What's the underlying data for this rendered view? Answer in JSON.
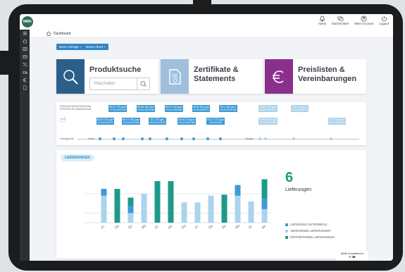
{
  "header": {
    "logo_text": "MMK",
    "nav": [
      {
        "label": "Alerts",
        "icon": "bell-icon"
      },
      {
        "label": "Nachrichten",
        "icon": "chat-icon"
      },
      {
        "label": "Mein Account",
        "icon": "user-icon"
      },
      {
        "label": "Logout",
        "icon": "power-icon"
      }
    ]
  },
  "breadcrumb": {
    "label": "Dashboard"
  },
  "actions": {
    "new_request": "Neue Anfrage +",
    "new_abruf": "Neuer Abruf +"
  },
  "cards": [
    {
      "title": "Produktsuche",
      "search_placeholder": "Platzhalter",
      "color": "#2a5f8a"
    },
    {
      "title": "Zertifikate &\nStatements",
      "color": "#9fbfdc"
    },
    {
      "title": "Preislisten &\nVereinbarungen",
      "color": "#8a2f8c"
    }
  ],
  "timeline": {
    "section_label": "PRODUKTIONSVORSCHAU\nFERTIGSTELLUNGSDATUM",
    "axis_labels": {
      "start": "Verfügbar bis",
      "heute": "Heute",
      "morgen": "Morgen"
    },
    "chips": [
      {
        "text": "EKCT 275 gsm\n17.04.2019 80",
        "faded": false
      },
      {
        "text": "BJHD 180 gsm\n19.04.2019 AB",
        "faded": false
      },
      {
        "text": "EKCT 230 gsm\n19.04.2019 80",
        "faded": false
      },
      {
        "text": "MCB 300 gsm\n19.04.2019 FL",
        "faded": false
      },
      {
        "text": "BCL 255 gsm\n19.04.2019 AB",
        "faded": false
      },
      {
        "text": "MCM 200 gsm\n17.04.2019 FL",
        "faded": false
      },
      {
        "text": "EKCT 250 gsm\n19.04.2019 AB",
        "faded": false
      },
      {
        "text": "KC 275 gsm\n19.04.2019 80",
        "faded": false
      },
      {
        "text": "MCM 275 gsm\n19.04.2019 AB",
        "faded": false
      },
      {
        "text": "EKCT 275 gsm\n19.04.2019",
        "faded": false
      },
      {
        "text": "CEEK 275 gsm\n22.04.2019 FL",
        "faded": true
      },
      {
        "text": "CMKR 300 gsm\n23.04.2019 AB",
        "faded": true
      },
      {
        "text": "GT 275 gsm\n24.04.2019 FL",
        "faded": true
      },
      {
        "text": "CKT 275 gsm\n29.04.2019 80",
        "faded": true
      }
    ]
  },
  "deliveries": {
    "label": "LIEFERUNGEN",
    "count": "6",
    "count_label": "Lieferungen",
    "colors": {
      "unterwegs": "#3d9ad6",
      "abgehend": "#aad3ee",
      "eintreffend": "#1e9a8a"
    },
    "legend": [
      {
        "label": "LIEFERUNG UNTERWEGS",
        "key": "unterwegs"
      },
      {
        "label": "ABGEHENDE LIEFERUNGEN",
        "key": "abgehend"
      },
      {
        "label": "EINTREFFENDE LIEFERUNGEN",
        "key": "eintreffend"
      }
    ]
  },
  "chart_data": {
    "type": "bar",
    "categories": [
      "Fr",
      "Sa",
      "So",
      "Mo",
      "Di",
      "Mi",
      "Do",
      "Fr",
      "Sa",
      "So",
      "Mo",
      "Di",
      "Mi"
    ],
    "series": [
      {
        "name": "ABGEHENDE LIEFERUNGEN",
        "values": [
          1.4,
          0,
          0.5,
          1.5,
          0,
          0,
          1.05,
          1.05,
          1.4,
          0,
          1.4,
          1.1,
          0.7
        ]
      },
      {
        "name": "LIEFERUNG UNTERWEGS",
        "values": [
          0.35,
          0,
          0.35,
          0,
          0,
          0,
          0,
          0,
          0,
          0,
          0.55,
          0,
          0.55
        ]
      },
      {
        "name": "EINTREFFENDE LIEFERUNGEN",
        "values": [
          0,
          1.75,
          0.45,
          0,
          2.15,
          2.15,
          0,
          0,
          0,
          1.45,
          0,
          0,
          1.0
        ]
      }
    ],
    "ylim": [
      0,
      2.3
    ],
    "grid": true,
    "legend_position": "right"
  },
  "contact": {
    "label": "MMK kontaktieren"
  }
}
